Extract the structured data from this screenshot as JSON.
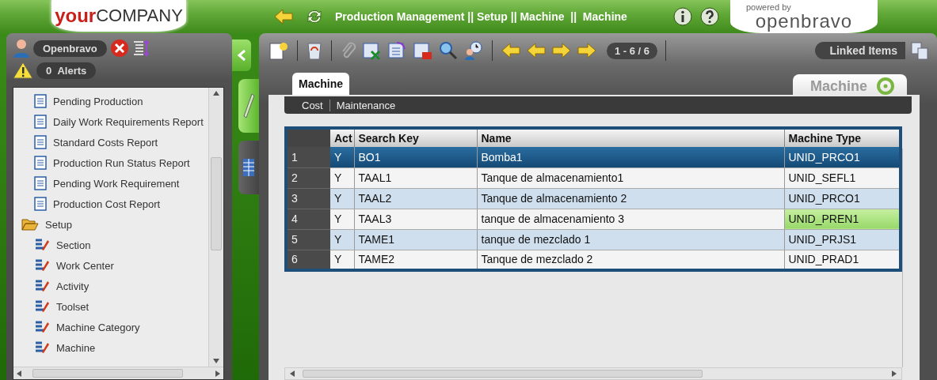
{
  "logo": {
    "bold": "your",
    "rest": "COMPANY"
  },
  "breadcrumb": "Production Management || Setup || Machine  ||  Machine",
  "powered": {
    "caption": "powered by",
    "brand": "openbravo"
  },
  "user": {
    "name": "Openbravo"
  },
  "alerts": {
    "count": "0",
    "label": "Alerts"
  },
  "tree": [
    {
      "label": "Pending Production",
      "kind": "report"
    },
    {
      "label": "Daily Work Requirements Report",
      "kind": "report"
    },
    {
      "label": "Standard Costs Report",
      "kind": "report"
    },
    {
      "label": "Production Run Status Report",
      "kind": "report"
    },
    {
      "label": "Pending Work Requirement",
      "kind": "report"
    },
    {
      "label": "Production Cost Report",
      "kind": "report"
    },
    {
      "label": "Setup",
      "kind": "folder",
      "expanded": true,
      "children": [
        {
          "label": "Section",
          "kind": "window"
        },
        {
          "label": "Work Center",
          "kind": "window"
        },
        {
          "label": "Activity",
          "kind": "window"
        },
        {
          "label": "Toolset",
          "kind": "window"
        },
        {
          "label": "Machine Category",
          "kind": "window"
        },
        {
          "label": "Machine",
          "kind": "window"
        }
      ]
    }
  ],
  "view_tabs": [
    {
      "kind": "form",
      "selected": false
    },
    {
      "kind": "grid",
      "selected": true
    }
  ],
  "record_counter": "1 - 6 / 6",
  "linked_items": "Linked Items",
  "tabs": [
    {
      "label": "Machine",
      "selected": true
    }
  ],
  "window_title": "Machine",
  "subtabs": [
    "Cost",
    "Maintenance"
  ],
  "table": {
    "columns": [
      "Act",
      "Search Key",
      "Name",
      "Machine Type"
    ],
    "rows": [
      {
        "num": "1",
        "cells": [
          "Y",
          "BO1",
          "Bomba1",
          "UNID_PRCO1"
        ],
        "selected": true,
        "highlighted": false
      },
      {
        "num": "2",
        "cells": [
          "Y",
          "TAAL1",
          "Tanque de almacenamiento1",
          "UNID_SEFL1"
        ],
        "selected": false,
        "highlighted": false
      },
      {
        "num": "3",
        "cells": [
          "Y",
          "TAAL2",
          "Tanque de almacenamiento 2",
          "UNID_PRCO1"
        ],
        "selected": false,
        "highlighted": false
      },
      {
        "num": "4",
        "cells": [
          "Y",
          "TAAL3",
          "tanque de almacenamiento 3",
          "UNID_PREN1"
        ],
        "selected": false,
        "highlighted": true
      },
      {
        "num": "5",
        "cells": [
          "Y",
          "TAME1",
          "tanque de mezclado 1",
          "UNID_PRJS1"
        ],
        "selected": false,
        "highlighted": false
      },
      {
        "num": "6",
        "cells": [
          "Y",
          "TAME2",
          "Tanque de mezclado 2",
          "UNID_PRAD1"
        ],
        "selected": false,
        "highlighted": false
      }
    ]
  }
}
